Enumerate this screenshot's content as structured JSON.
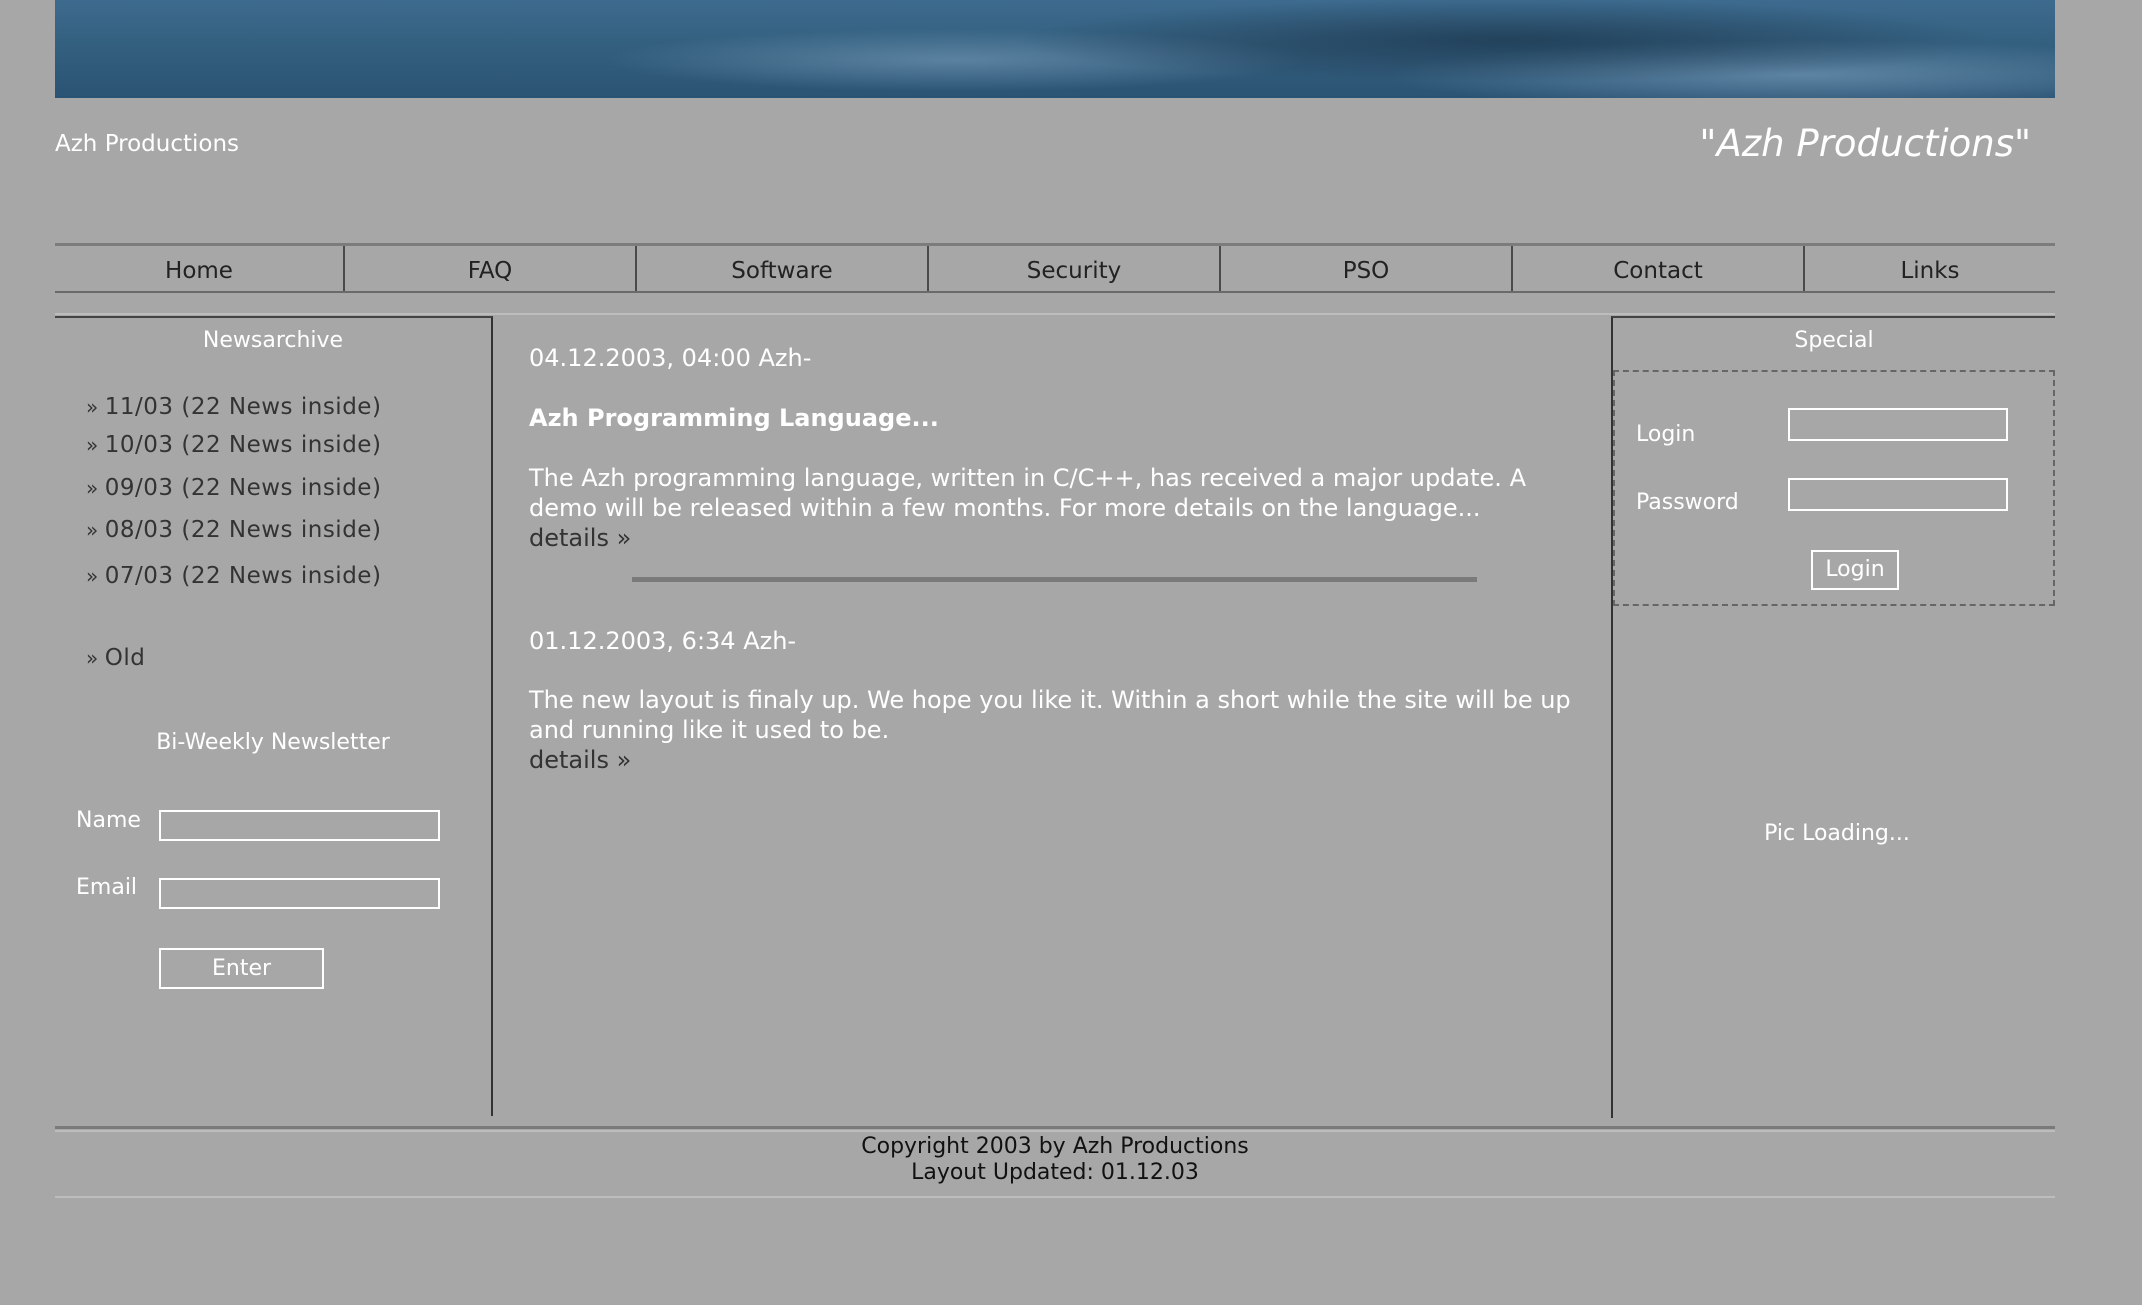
{
  "header": {
    "site_name": "Azh Productions",
    "tagline": "\"Azh Productions\""
  },
  "nav": {
    "items": [
      "Home",
      "FAQ",
      "Software",
      "Security",
      "PSO",
      "Contact",
      "Links"
    ]
  },
  "left": {
    "archive_title": "Newsarchive",
    "archive_items": [
      "11/03 (22 News inside)",
      "10/03 (22 News inside)",
      "09/03 (22 News inside)",
      "08/03 (22 News inside)",
      "07/03 (22 News inside)"
    ],
    "old_label": "Old",
    "bullet": "»",
    "newsletter_title": "Bi-Weekly Newsletter",
    "name_label": "Name",
    "email_label": "Email",
    "name_value": "",
    "email_value": "",
    "enter_label": "Enter"
  },
  "content": {
    "posts": [
      {
        "date": "04.12.2003, 04:00 Azh-",
        "title": "Azh Programming Language...",
        "body": "The Azh programming language, written in C/C++, has received a major update. A demo will be released within a few months. For more details on the language...",
        "details": "details »"
      },
      {
        "date": "01.12.2003, 6:34 Azh-",
        "title": "",
        "body": "The new layout is finaly up. We hope you like it. Within a short while the site will be up and running like it used to be.",
        "details": "details »"
      }
    ]
  },
  "right": {
    "special_title": "Special",
    "login_label": "Login",
    "password_label": "Password",
    "login_value": "",
    "password_value": "",
    "login_button": "Login",
    "pic_loading": "Pic Loading..."
  },
  "footer": {
    "copyright": "Copyright 2003 by Azh Productions",
    "updated": "Layout Updated: 01.12.03"
  },
  "colors": {
    "background": "#a7a7a7",
    "banner": "#34607f",
    "text_light": "#ffffff",
    "text_dark": "#333333"
  }
}
